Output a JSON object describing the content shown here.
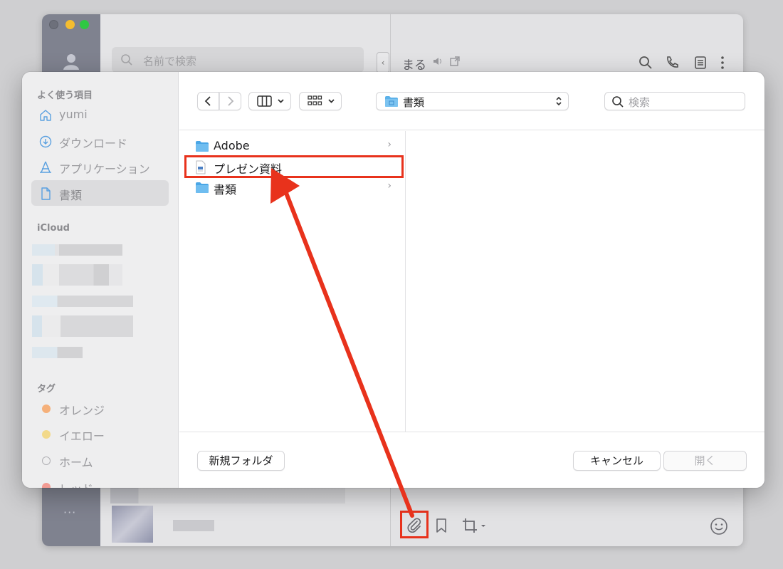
{
  "background_app": {
    "search_placeholder": "名前で検索",
    "chat_title": "まる",
    "rail_more": "···",
    "collapse_arrow": "‹"
  },
  "dialog": {
    "sidebar": {
      "favorites_header": "よく使う項目",
      "favorites": [
        {
          "label": "yumi",
          "icon": "home-icon"
        },
        {
          "label": "ダウンロード",
          "icon": "download-icon"
        },
        {
          "label": "アプリケーション",
          "icon": "applications-icon"
        },
        {
          "label": "書類",
          "icon": "document-icon",
          "selected": true
        }
      ],
      "icloud_header": "iCloud",
      "tags_header": "タグ",
      "tags": [
        {
          "label": "オレンジ",
          "color": "#f5a55a"
        },
        {
          "label": "イエロー",
          "color": "#f2d15a"
        },
        {
          "label": "ホーム",
          "color": "none"
        },
        {
          "label": "レッド",
          "color": "#f06a5e"
        }
      ]
    },
    "toolbar": {
      "path_label": "書類",
      "search_placeholder": "検索"
    },
    "files": [
      {
        "name": "Adobe",
        "type": "folder",
        "has_children": true
      },
      {
        "name": "プレゼン資料",
        "type": "document",
        "has_children": false,
        "highlighted": true
      },
      {
        "name": "書類",
        "type": "folder",
        "has_children": true
      }
    ],
    "footer": {
      "new_folder": "新規フォルダ",
      "cancel": "キャンセル",
      "open": "開く"
    }
  },
  "colors": {
    "annotation_red": "#e8321c",
    "folder_blue": "#5cb2ea"
  }
}
